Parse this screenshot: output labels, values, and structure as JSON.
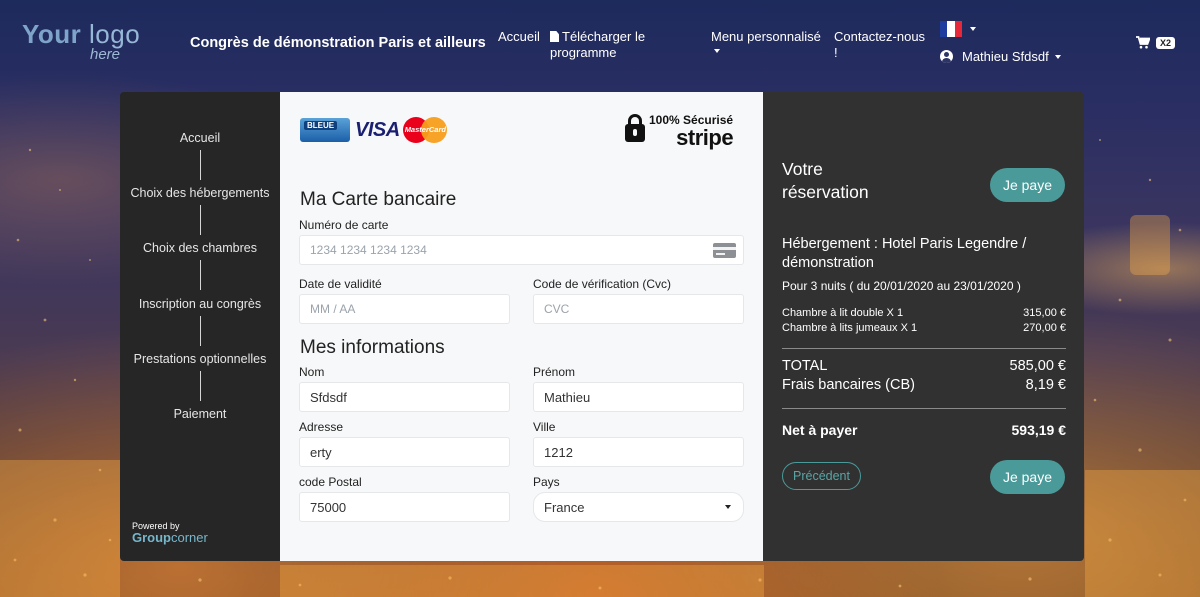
{
  "header": {
    "logo_main_bold": "Your",
    "logo_main_light": "logo",
    "logo_sub": "here",
    "event_title": "Congrès de démonstration Paris et ailleurs",
    "nav": {
      "home": "Accueil",
      "download": "Télécharger le programme",
      "custom_menu": "Menu personnalisé",
      "contact": "Contactez-nous !"
    },
    "language_flag": "flag-fr",
    "user_name": "Mathieu Sfdsdf",
    "cart_count": "X2"
  },
  "steps": {
    "items": [
      "Accueil",
      "Choix des hébergements",
      "Choix des chambres",
      "Inscription au congrès",
      "Prestations optionnelles",
      "Paiement"
    ],
    "powered_by": "Powered by",
    "brand_bold": "Group",
    "brand_light": "corner"
  },
  "payment": {
    "card_logo_cb": "BLEUE",
    "card_logo_visa": "VISA",
    "card_logo_mc": "MasterCard",
    "secure_label": "100% Sécurisé",
    "secure_brand": "stripe",
    "card_section_title": "Ma Carte bancaire",
    "card_number_label": "Numéro de carte",
    "card_number_placeholder": "1234 1234 1234 1234",
    "expiry_label": "Date de validité",
    "expiry_placeholder": "MM / AA",
    "cvc_label": "Code de vérification (Cvc)",
    "cvc_placeholder": "CVC"
  },
  "info": {
    "section_title": "Mes informations",
    "last_name_label": "Nom",
    "last_name_value": "Sfdsdf",
    "first_name_label": "Prénom",
    "first_name_value": "Mathieu",
    "address_label": "Adresse",
    "address_value": "erty",
    "city_label": "Ville",
    "city_value": "1212",
    "postal_label": "code Postal",
    "postal_value": "75000",
    "country_label": "Pays",
    "country_value": "France"
  },
  "summary": {
    "title": "Votre réservation",
    "pay_button": "Je paye",
    "hotel": "Hébergement : Hotel Paris Legendre / démonstration",
    "nights": "Pour 3 nuits ( du 20/01/2020 au 23/01/2020 )",
    "lines": [
      {
        "label": "Chambre à lit double X 1",
        "amount": "315,00 €"
      },
      {
        "label": "Chambre à lits jumeaux X 1",
        "amount": "270,00 €"
      }
    ],
    "total_label": "TOTAL",
    "total_value": "585,00 €",
    "fees_label": "Frais bancaires (CB)",
    "fees_value": "8,19 €",
    "net_label": "Net à payer",
    "net_value": "593,19 €",
    "prev_button": "Précédent"
  },
  "colors": {
    "accent": "#4a9a9a",
    "sidebar_bg": "#262626",
    "summary_bg": "#313131"
  }
}
